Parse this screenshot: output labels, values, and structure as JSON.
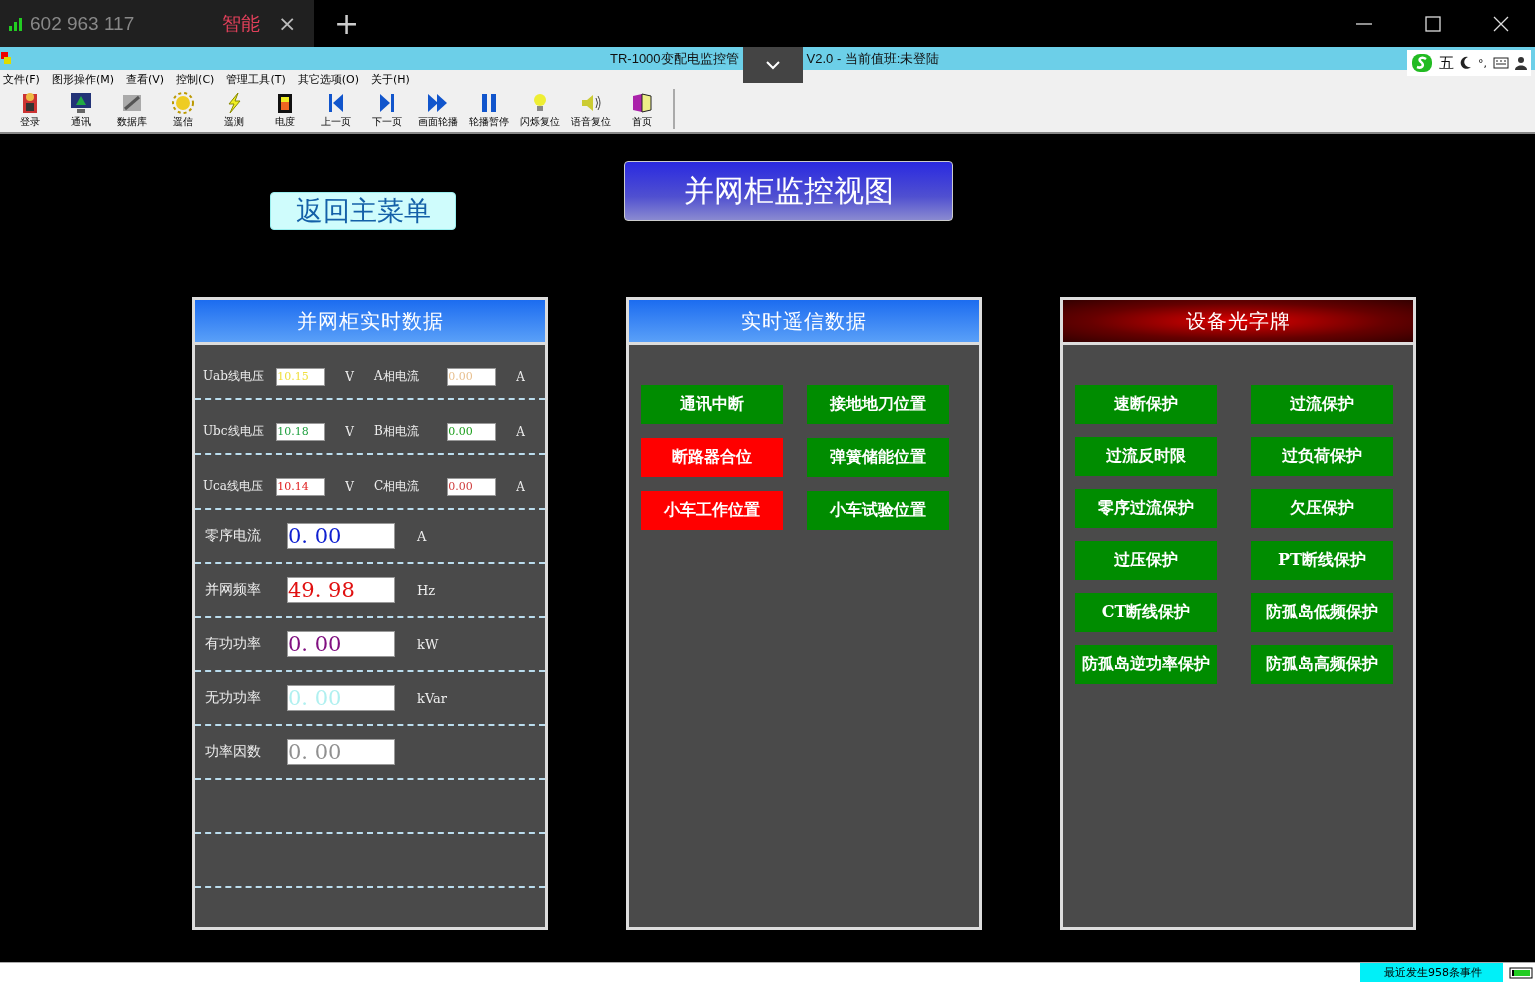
{
  "browser_tab": {
    "title": "602 963 117",
    "badge": "智能",
    "close": "×",
    "new_tab": "+"
  },
  "window": {
    "title_left": "TR-1000变配电监控管",
    "title_right": "V2.0 - 当前值班:未登陆"
  },
  "ime_bar": {
    "mode": "五",
    "punct": "°,"
  },
  "menu": [
    "文件(F)",
    "图形操作(M)",
    "查看(V)",
    "控制(C)",
    "管理工具(T)",
    "其它选项(O)",
    "关于(H)"
  ],
  "toolbar": [
    "登录",
    "通讯",
    "数据库",
    "遥信",
    "遥测",
    "电度",
    "上一页",
    "下一页",
    "画面轮播",
    "轮播暂停",
    "闪烁复位",
    "语音复位",
    "首页"
  ],
  "back_button": "返回主菜单",
  "view_title": "并网柜监控视图",
  "realtime_panel": {
    "title": "并网柜实时数据",
    "rows": [
      {
        "kind": "pair",
        "cells": [
          {
            "label": "Uab线电压",
            "value": "10.15",
            "color": "#f0e040",
            "unit": "V"
          },
          {
            "label": "A相电流",
            "value": "0.00",
            "color": "#e8c090",
            "unit": "A"
          }
        ]
      },
      {
        "kind": "pair",
        "cells": [
          {
            "label": "Ubc线电压",
            "value": "10.18",
            "color": "#20a040",
            "unit": "V"
          },
          {
            "label": "B相电流",
            "value": "0.00",
            "color": "#20a020",
            "unit": "A"
          }
        ]
      },
      {
        "kind": "pair",
        "cells": [
          {
            "label": "Uca线电压",
            "value": "10.14",
            "color": "#e02020",
            "unit": "V"
          },
          {
            "label": "C相电流",
            "value": "0.00",
            "color": "#d04040",
            "unit": "A"
          }
        ]
      },
      {
        "kind": "single",
        "label": "零序电流",
        "value": "0. 00",
        "color": "#1020d0",
        "unit": "A"
      },
      {
        "kind": "single",
        "label": "并网频率",
        "value": "49. 98",
        "color": "#e01010",
        "unit": "Hz"
      },
      {
        "kind": "single",
        "label": "有功功率",
        "value": "0. 00",
        "color": "#801080",
        "unit": "kW"
      },
      {
        "kind": "single",
        "label": "无功功率",
        "value": "0. 00",
        "color": "#b0f0f0",
        "unit": "kVar"
      },
      {
        "kind": "single",
        "label": "功率因数",
        "value": "0. 00",
        "color": "#909090"
      }
    ]
  },
  "signal_panel": {
    "title": "实时遥信数据",
    "items": [
      {
        "label": "通讯中断",
        "color": "#008c00"
      },
      {
        "label": "接地地刀位置",
        "color": "#008c00"
      },
      {
        "label": "断路器合位",
        "color": "#ff0000"
      },
      {
        "label": "弹簧储能位置",
        "color": "#008c00"
      },
      {
        "label": "小车工作位置",
        "color": "#ff0000"
      },
      {
        "label": "小车试验位置",
        "color": "#008c00"
      }
    ]
  },
  "annunciator_panel": {
    "title": "设备光字牌",
    "items": [
      {
        "label": "速断保护",
        "color": "#008c00"
      },
      {
        "label": "过流保护",
        "color": "#008c00"
      },
      {
        "label": "过流反时限",
        "color": "#008c00"
      },
      {
        "label": "过负荷保护",
        "color": "#008c00"
      },
      {
        "label": "零序过流保护",
        "color": "#008c00"
      },
      {
        "label": "欠压保护",
        "color": "#008c00"
      },
      {
        "label": "过压保护",
        "color": "#008c00"
      },
      {
        "label": "PT断线保护",
        "color": "#008c00"
      },
      {
        "label": "CT断线保护",
        "color": "#008c00"
      },
      {
        "label": "防孤岛低频保护",
        "color": "#008c00"
      },
      {
        "label": "防孤岛逆功率保护",
        "color": "#008c00"
      },
      {
        "label": "防孤岛高频保护",
        "color": "#008c00"
      }
    ]
  },
  "status_bar": {
    "events": "最近发生958条事件"
  }
}
